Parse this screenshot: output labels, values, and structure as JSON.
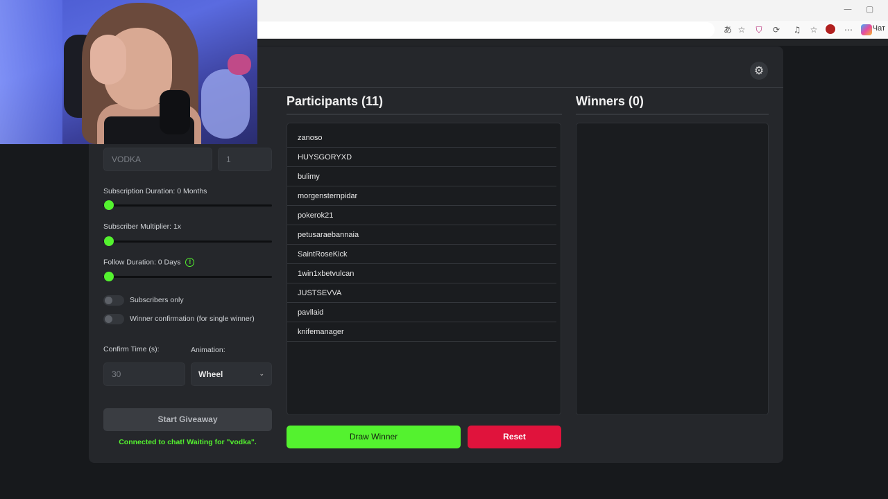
{
  "browser": {
    "minimize_glyph": "—",
    "restore_glyph": "▢",
    "translate_glyph": "あ",
    "star_glyph": "☆",
    "shield_glyph": "⛉",
    "extensions_glyph": "⟳",
    "favorites_glyph": "☆",
    "more_glyph": "⋯",
    "chat_label": "Чат"
  },
  "settings": {
    "gear_glyph": "⚙"
  },
  "form": {
    "keyword_value": "VODKA",
    "count_value": "1",
    "subscription_duration_label": "Subscription Duration: 0 Months",
    "subscriber_multiplier_label": "Subscriber Multiplier: 1x",
    "follow_duration_label": "Follow Duration:  0  Days",
    "info_glyph": "!",
    "subscribers_only_label": "Subscribers only",
    "winner_confirmation_label": "Winner confirmation (for single winner)",
    "confirm_time_label": "Confirm Time (s):",
    "confirm_time_value": "30",
    "animation_label": "Animation:",
    "animation_value": "Wheel",
    "chevron_glyph": "⌄",
    "start_button": "Start Giveaway",
    "status_text": "Connected to chat! Waiting for \"vodka\"."
  },
  "sliders": {
    "subscription_months": 0,
    "subscriber_multiplier": 1,
    "follow_days": 0
  },
  "toggles": {
    "subscribers_only": false,
    "winner_confirmation": false
  },
  "participants": {
    "title": "Participants (11)",
    "items": [
      "zanoso",
      "HUYSGORYXD",
      "bulimy",
      "morgensternpidar",
      "pokerok21",
      "petusaraebannaia",
      "SaintRoseKick",
      "1win1xbetvulcan",
      "JUSTSEVVA",
      "pavllaid",
      "knifemanager"
    ]
  },
  "winners": {
    "title": "Winners (0)",
    "items": []
  },
  "actions": {
    "draw_button": "Draw Winner",
    "reset_button": "Reset"
  },
  "colors": {
    "accent": "#54f22f",
    "danger": "#e0133c",
    "card": "#25272b",
    "background": "#17191c"
  }
}
